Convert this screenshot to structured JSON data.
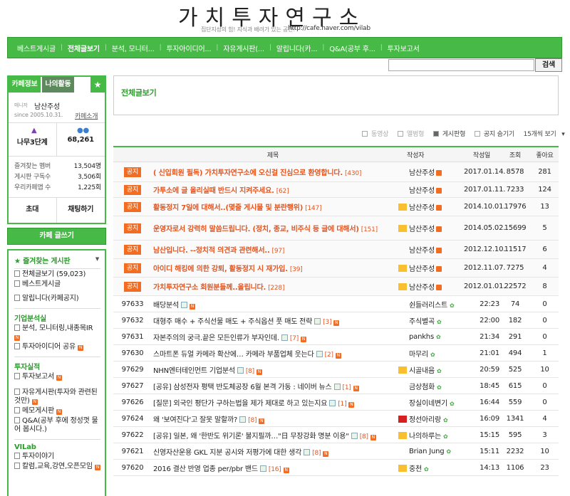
{
  "header": {
    "title": "가치투자연구소",
    "slogan": "집단지성의 힘! 지식과 배려가 있는 공간!",
    "url": "http://cafe.naver.com/vilab"
  },
  "nav": [
    "베스트게시글",
    "전체글보기",
    "분석, 모니터...",
    "투자아이디어...",
    "자유게시판(...",
    "알립니다(카...",
    "Q&A(공부 후...",
    "투자보고서"
  ],
  "search": {
    "button": "검색"
  },
  "cafe": {
    "tab1": "카페정보",
    "tab2": "나의활동",
    "manager_label": "매니저",
    "manager": "남산주성",
    "since": "since 2005.10.31.",
    "intro": "카페소개",
    "level": "나무3단계",
    "members": "68,261",
    "info": [
      {
        "label": "즐겨찾는 멤버",
        "value": "13,504명"
      },
      {
        "label": "게시판 구독수",
        "value": "3,506회"
      },
      {
        "label": "우리카페앱 수",
        "value": "1,225회"
      }
    ],
    "btn_invite": "초대",
    "btn_chat": "채팅하기",
    "write": "카페 글쓰기"
  },
  "boards": {
    "fav": "즐겨찾는 게시판",
    "items1": [
      "전체글보기 (59,023)",
      "베스트게시글"
    ],
    "notice": "알립니다(카페공지)",
    "sec1": "기업분석실",
    "items2": [
      "분석, 모니터링,내종목IR",
      "투자아이디어 공유"
    ],
    "sec2": "투자실적",
    "items3": [
      "투자보고서"
    ],
    "items4": [
      "자유게시판(투자와 관련된 것만)",
      "메모게시판",
      "Q&A(공부 후에 정성껏 물어 봅시다.)"
    ],
    "sec3": "VILab",
    "items5": [
      "투자이야기",
      "칼럼,교육,강연,오픈모임"
    ]
  },
  "page": {
    "title": "전체글보기"
  },
  "view_opts": {
    "a": "동영상",
    "b": "앨범형",
    "c": "게시판형",
    "d": "공지 숨기기",
    "e": "15개씩 보기"
  },
  "columns": {
    "title": "제목",
    "author": "작성자",
    "date": "작성일",
    "views": "조회",
    "likes": "좋아요"
  },
  "notices": [
    {
      "tag": "공지",
      "title": "( 신입회원 필독) 가치투자연구소에 오신걸 진심으로 환영합니다.",
      "cc": "[430]",
      "author": "남산주성",
      "date": "2017.01.14.",
      "views": "8578",
      "likes": "281"
    },
    {
      "tag": "공지",
      "title": "가투소에 글 올리실때 반드시 지켜주세요.",
      "cc": "[62]",
      "author": "남산주성",
      "date": "2017.01.11.",
      "views": "7233",
      "likes": "124"
    },
    {
      "tag": "공지",
      "title": "활동정지 7일에 대해서..(몇줄 게시물 및 분란행위)",
      "cc": "[147]",
      "author": "남산주성",
      "date": "2014.10.01.",
      "views": "17976",
      "likes": "13"
    },
    {
      "tag": "공지",
      "title": "운영자로서 강력히 말씀드립니다. (정치, 종교, 비주식 등 글에 대해서)",
      "cc": "[151]",
      "author": "남산주성",
      "date": "2014.05.02.",
      "views": "15699",
      "likes": "5"
    },
    {
      "tag": "공지",
      "title": "남산입니다. --정치적 의견과 관련해서..",
      "cc": "[97]",
      "author": "남산주성",
      "date": "2012.12.10.",
      "views": "11517",
      "likes": "6"
    },
    {
      "tag": "공지",
      "title": "아이디 해킹에 의한 강퇴, 활동정지 시 재가입.",
      "cc": "[39]",
      "author": "남산주성",
      "date": "2012.11.07.",
      "views": "7275",
      "likes": "4"
    },
    {
      "tag": "공지",
      "title": "가치투자연구소 회원분들께..올립니다.",
      "cc": "[228]",
      "author": "남산주성",
      "date": "2012.01.01.",
      "views": "22572",
      "likes": "8"
    }
  ],
  "posts": [
    {
      "no": "97633",
      "title": "배당분석",
      "cc": "",
      "author": "쉰들러리스트",
      "date": "22:23",
      "views": "74",
      "likes": "0"
    },
    {
      "no": "97632",
      "title": "대형주 매수 + 주식선물 매도 + 주식옵션 풋 매도 전략",
      "cc": "[3]",
      "author": "주식별곡",
      "date": "22:00",
      "views": "182",
      "likes": "0"
    },
    {
      "no": "97631",
      "title": "자본주의의 궁극.끝은 모든인류가 부자인데.",
      "cc": "[7]",
      "author": "pankhs",
      "date": "21:34",
      "views": "291",
      "likes": "0"
    },
    {
      "no": "97630",
      "title": "스마트폰 듀얼 카메라 확산에… 카메라 부품업체 웃는다",
      "cc": "[2]",
      "author": "마무리",
      "date": "21:01",
      "views": "494",
      "likes": "1"
    },
    {
      "no": "97629",
      "title": "NHN엔터테인먼트 기업분석",
      "cc": "[8]",
      "author": "시골내음",
      "date": "20:59",
      "views": "525",
      "likes": "10"
    },
    {
      "no": "97627",
      "title": "[공유] 삼성전자 평택 반도체공장 6월 본격 가동 : 네이버 뉴스",
      "cc": "[1]",
      "author": "금상첨화",
      "date": "18:45",
      "views": "615",
      "likes": "0"
    },
    {
      "no": "97626",
      "title": "[질문] 외국인 평단가 구하는법을 제가 제대로 하고 있는지요",
      "cc": "[1]",
      "author": "장실이네변기",
      "date": "16:44",
      "views": "559",
      "likes": "0"
    },
    {
      "no": "97624",
      "title": "왜 '보여진다'고 잘못 말할까?",
      "cc": "[8]",
      "author": "정선아리랑",
      "date": "16:09",
      "views": "1341",
      "likes": "4"
    },
    {
      "no": "97622",
      "title": "[공유] 일본, 왜 '한반도 위기론' 불지필까…\"日 무장강화 명분 이용\"",
      "cc": "[8]",
      "author": "나의하루는",
      "date": "15:15",
      "views": "595",
      "likes": "3"
    },
    {
      "no": "97621",
      "title": "신영자산운용 GKL 지분 공시와 저평가에 대한 생각",
      "cc": "[8]",
      "author": "Brian Jung",
      "date": "15:11",
      "views": "2232",
      "likes": "10"
    },
    {
      "no": "97620",
      "title": "2016 결산 반영 업종 per/pbr 밴드",
      "cc": "[16]",
      "author": "중천",
      "date": "14:13",
      "views": "1106",
      "likes": "23"
    }
  ]
}
